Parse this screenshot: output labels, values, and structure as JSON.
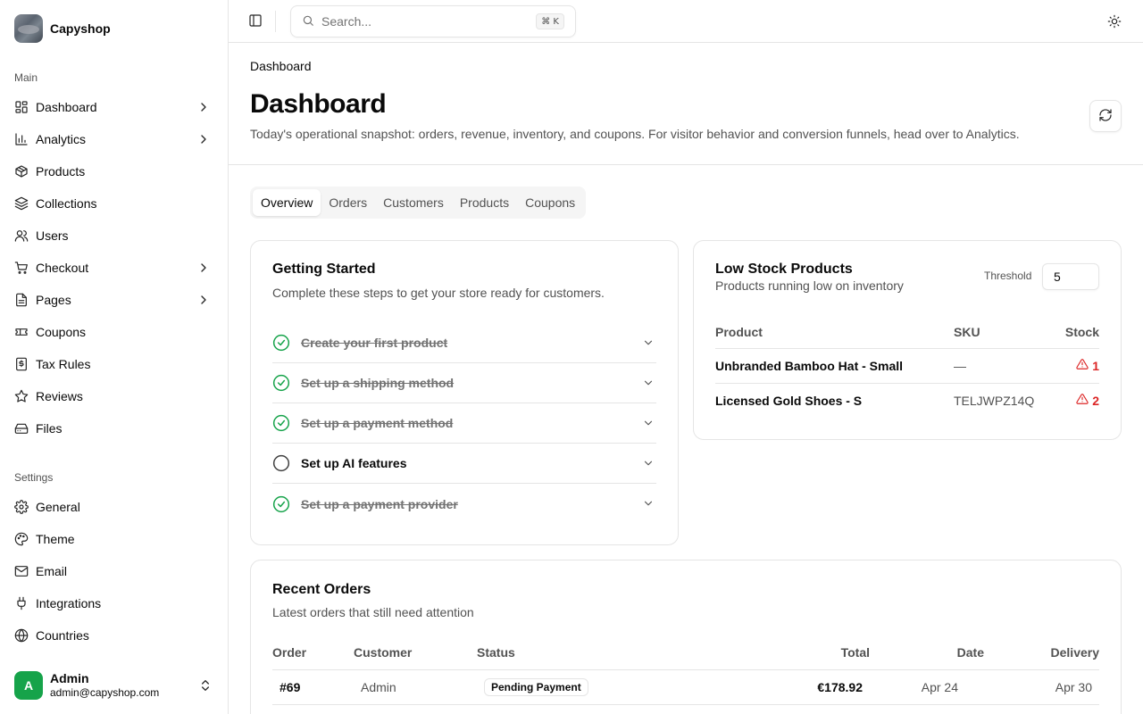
{
  "brand": {
    "name": "Capyshop"
  },
  "sidebar": {
    "main_label": "Main",
    "main_items": [
      {
        "label": "Dashboard",
        "icon": "layout-dashboard-icon",
        "has_chevron": true
      },
      {
        "label": "Analytics",
        "icon": "bar-chart-icon",
        "has_chevron": true
      },
      {
        "label": "Products",
        "icon": "package-icon",
        "has_chevron": false
      },
      {
        "label": "Collections",
        "icon": "layers-icon",
        "has_chevron": false
      },
      {
        "label": "Users",
        "icon": "users-icon",
        "has_chevron": false
      },
      {
        "label": "Checkout",
        "icon": "shopping-cart-icon",
        "has_chevron": true
      },
      {
        "label": "Pages",
        "icon": "file-text-icon",
        "has_chevron": true
      },
      {
        "label": "Coupons",
        "icon": "ticket-icon",
        "has_chevron": false
      },
      {
        "label": "Tax Rules",
        "icon": "receipt-icon",
        "has_chevron": false
      },
      {
        "label": "Reviews",
        "icon": "star-icon",
        "has_chevron": false
      },
      {
        "label": "Files",
        "icon": "hard-drive-icon",
        "has_chevron": false
      }
    ],
    "settings_label": "Settings",
    "settings_items": [
      {
        "label": "General",
        "icon": "gear-icon"
      },
      {
        "label": "Theme",
        "icon": "palette-icon"
      },
      {
        "label": "Email",
        "icon": "mail-icon"
      },
      {
        "label": "Integrations",
        "icon": "plug-icon"
      },
      {
        "label": "Countries",
        "icon": "globe-icon"
      }
    ],
    "user": {
      "initial": "A",
      "name": "Admin",
      "email": "admin@capyshop.com"
    }
  },
  "topbar": {
    "search_placeholder": "Search...",
    "search_shortcut": "⌘ K"
  },
  "header": {
    "breadcrumb": "Dashboard",
    "title": "Dashboard",
    "description": "Today's operational snapshot: orders, revenue, inventory, and coupons. For visitor behavior and conversion funnels, head over to Analytics."
  },
  "tabs": [
    {
      "label": "Overview",
      "active": true
    },
    {
      "label": "Orders",
      "active": false
    },
    {
      "label": "Customers",
      "active": false
    },
    {
      "label": "Products",
      "active": false
    },
    {
      "label": "Coupons",
      "active": false
    }
  ],
  "getting_started": {
    "title": "Getting Started",
    "description": "Complete these steps to get your store ready for customers.",
    "steps": [
      {
        "label": "Create your first product",
        "done": true
      },
      {
        "label": "Set up a shipping method",
        "done": true
      },
      {
        "label": "Set up a payment method",
        "done": true
      },
      {
        "label": "Set up AI features",
        "done": false
      },
      {
        "label": "Set up a payment provider",
        "done": true
      }
    ]
  },
  "low_stock": {
    "title": "Low Stock Products",
    "description": "Products running low on inventory",
    "threshold_label": "Threshold",
    "threshold_value": "5",
    "columns": {
      "product": "Product",
      "sku": "SKU",
      "stock": "Stock"
    },
    "rows": [
      {
        "product": "Unbranded Bamboo Hat - Small",
        "sku": "—",
        "stock": "1"
      },
      {
        "product": "Licensed Gold Shoes - S",
        "sku": "TELJWPZ14Q",
        "stock": "2"
      }
    ]
  },
  "recent_orders": {
    "title": "Recent Orders",
    "description": "Latest orders that still need attention",
    "columns": {
      "order": "Order",
      "customer": "Customer",
      "status": "Status",
      "total": "Total",
      "date": "Date",
      "delivery": "Delivery"
    },
    "rows": [
      {
        "order": "#69",
        "customer": "Admin",
        "status": "Pending Payment",
        "total": "€178.92",
        "date": "Apr 24",
        "delivery": "Apr 30"
      }
    ]
  },
  "colors": {
    "success": "#16a34a",
    "danger": "#dc2626",
    "avatar": "#16a34a"
  }
}
